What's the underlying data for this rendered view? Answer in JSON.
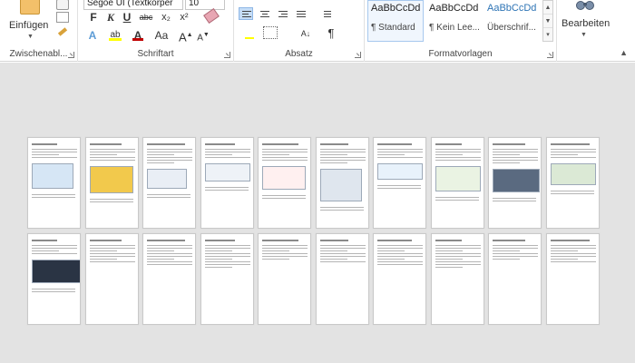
{
  "ribbon": {
    "clipboard": {
      "paste_label": "Einfügen",
      "group_label": "Zwischenabl...",
      "icons": [
        "paste-icon",
        "cut-icon",
        "copy-icon",
        "format-painter-icon"
      ]
    },
    "font": {
      "font_name": "Segoe UI (Textkörper",
      "font_size": "10",
      "bold": "F",
      "italic": "K",
      "underline": "U",
      "strikethrough": "abc",
      "subscript": "x₂",
      "superscript": "x²",
      "font_color_label": "A",
      "highlight_label": "ab",
      "case_label": "Aa",
      "grow_label": "A",
      "shrink_label": "A",
      "text_effects_label": "A",
      "group_label": "Schriftart",
      "highlight_color": "#ffff00",
      "font_color": "#c00000"
    },
    "paragraph": {
      "group_label": "Absatz",
      "pilcrow": "¶",
      "sort_label": "A↓"
    },
    "styles": {
      "group_label": "Formatvorlagen",
      "items": [
        {
          "sample": "AaBbCcDd",
          "name": "¶ Standard"
        },
        {
          "sample": "AaBbCcDd",
          "name": "¶ Kein Lee..."
        },
        {
          "sample": "AaBbCcDd",
          "name": "Überschrif..."
        }
      ],
      "heading_color": "#2e74b5"
    },
    "editing": {
      "label": "Bearbeiten"
    }
  },
  "document": {
    "view": "multi-page",
    "background": "#e3e3e3",
    "page_rows": 2,
    "pages_per_row": 10
  }
}
